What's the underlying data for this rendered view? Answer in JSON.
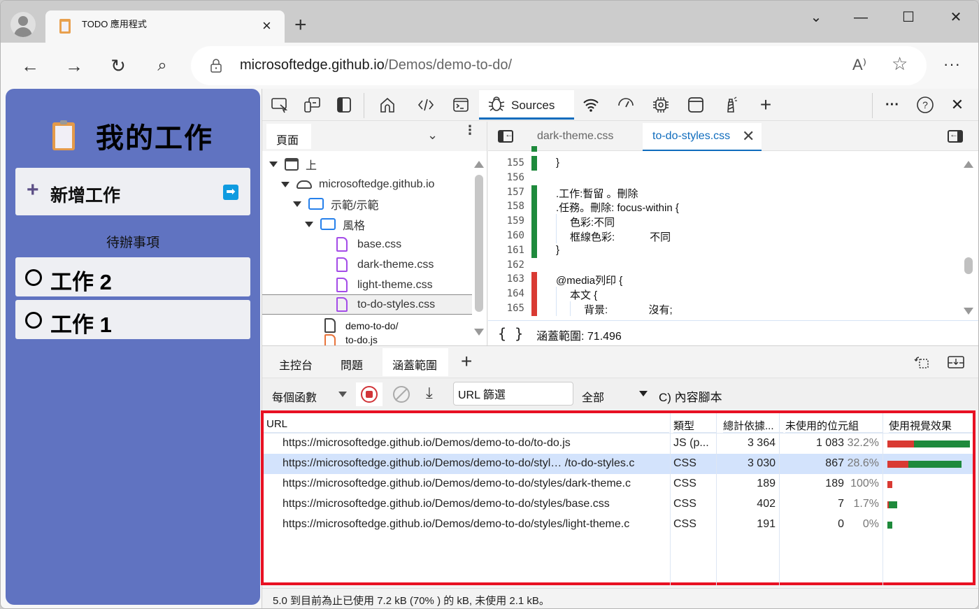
{
  "browser": {
    "tab_title": "TODO 應用程式",
    "tab_close": "×",
    "new_tab": "+",
    "window_controls": {
      "tab_search": "⌄",
      "minimize": "—",
      "maximize": "☐",
      "close": "✕"
    },
    "nav": {
      "back": "←",
      "forward": "→",
      "refresh": "↻",
      "search": "⌕"
    },
    "url_host": "microsoftedge.github.io",
    "url_path": "/Demos/demo-to-do/",
    "read_aloud": "A⁾",
    "favorite": "☆",
    "more": "···"
  },
  "app": {
    "title": "我的工作",
    "add_task_label": "新增工作",
    "add_task_plus": "+",
    "add_task_submit": "➡",
    "section_title": "待辦事項",
    "tasks": [
      {
        "label": "工作 2"
      },
      {
        "label": "工作 1"
      }
    ]
  },
  "devtools": {
    "toolbar": {
      "active_tab": "Sources",
      "more": "···",
      "help": "?",
      "close": "✕",
      "add": "+"
    },
    "navigator": {
      "tab": "頁面",
      "tree": [
        {
          "label": "上",
          "type": "frame",
          "depth": 0
        },
        {
          "label": "microsoftedge.github.io",
          "type": "domain",
          "depth": 1
        },
        {
          "label": "示範/示範",
          "type": "folder",
          "depth": 2
        },
        {
          "label": "風格",
          "type": "folder",
          "depth": 3
        },
        {
          "label": "base.css",
          "type": "css",
          "depth": 4
        },
        {
          "label": "dark-theme.css",
          "type": "css",
          "depth": 4
        },
        {
          "label": "light-theme.css",
          "type": "css",
          "depth": 4
        },
        {
          "label": "to-do-styles.css",
          "type": "css",
          "depth": 4,
          "selected": true
        },
        {
          "label": "demo-to-do/",
          "type": "document",
          "depth": 3
        },
        {
          "label": "to-do.js",
          "type": "js",
          "depth": 3
        }
      ]
    },
    "editor": {
      "tabs": [
        {
          "label": "dark-theme.css",
          "active": false
        },
        {
          "label": "to-do-styles.css",
          "active": true
        }
      ],
      "tab_close": "✕",
      "lines": [
        {
          "num": "155",
          "code": "}",
          "coverage": "used",
          "indent": 1
        },
        {
          "num": "156",
          "code": "",
          "coverage": "none",
          "indent": 0
        },
        {
          "num": "157",
          "code": ".工作:暫留 。刪除",
          "coverage": "used",
          "indent": 1
        },
        {
          "num": "158",
          "code": ".任務。刪除: focus-within {",
          "coverage": "used",
          "indent": 1
        },
        {
          "num": "159",
          "code": "色彩:不同",
          "coverage": "used",
          "indent": 2
        },
        {
          "num": "160",
          "code": "框線色彩:            不同",
          "coverage": "used",
          "indent": 2
        },
        {
          "num": "161",
          "code": "}",
          "coverage": "used",
          "indent": 1
        },
        {
          "num": "162",
          "code": "",
          "coverage": "none",
          "indent": 0
        },
        {
          "num": "163",
          "code": "@media列印 {",
          "coverage": "unused",
          "indent": 1
        },
        {
          "num": "164",
          "code": "本文 {",
          "coverage": "unused",
          "indent": 2
        },
        {
          "num": "165",
          "code": "背景:              沒有;",
          "coverage": "unused",
          "indent": 3
        }
      ],
      "footer_braces": "{ }",
      "footer_coverage": "涵蓋範圍: 71.496"
    },
    "drawer": {
      "tabs": [
        {
          "label": "主控台",
          "active": false
        },
        {
          "label": "問題",
          "active": false
        },
        {
          "label": "涵蓋範圍",
          "active": true
        }
      ],
      "add": "+"
    },
    "coverage": {
      "type_select": "每個函數",
      "url_filter_value": "URL 篩選",
      "all_select": "全部",
      "content_scripts": "C) 內容腳本",
      "export_icon": "⤓",
      "columns": [
        "URL",
        "類型",
        "總計依據...",
        "未使用的位元組",
        "使用視覺效果"
      ],
      "rows": [
        {
          "url": "https://microsoftedge.github.io/Demos/demo-to-do/to-do.js",
          "type": "JS (p...",
          "total": "3 364",
          "unused": "1 083",
          "unused_pct": "32.2%",
          "unused_fraction": 0.322,
          "total_value": 3364,
          "selected": false
        },
        {
          "url": "https://microsoftedge.github.io/Demos/demo-to-do/styl… /to-do-styles.c",
          "type": "CSS",
          "total": "3 030",
          "unused": "867",
          "unused_pct": "28.6%",
          "unused_fraction": 0.286,
          "total_value": 3030,
          "selected": true
        },
        {
          "url": "https://microsoftedge.github.io/Demos/demo-to-do/styles/dark-theme.c",
          "type": "CSS",
          "total": "189",
          "unused": "189",
          "unused_pct": "100%",
          "unused_fraction": 1.0,
          "total_value": 189,
          "selected": false
        },
        {
          "url": "https://microsoftedge.github.io/Demos/demo-to-do/styles/base.css",
          "type": "CSS",
          "total": "402",
          "unused": "7",
          "unused_pct": "1.7%",
          "unused_fraction": 0.017,
          "total_value": 402,
          "selected": false
        },
        {
          "url": "https://microsoftedge.github.io/Demos/demo-to-do/styles/light-theme.c",
          "type": "CSS",
          "total": "191",
          "unused": "0",
          "unused_pct": "0%",
          "unused_fraction": 0.0,
          "total_value": 191,
          "selected": false
        }
      ],
      "status": "5.0 到目前為止已使用 7.2 kB (70% ) 的 kB, 未使用 2.1 kB。"
    }
  },
  "colors": {
    "app_bg": "#6073c1",
    "used": "#1e8a3c",
    "unused": "#d93a33",
    "accent": "#0f6cbd",
    "highlight_border": "#e81123",
    "selected_row": "#d3e3fc"
  }
}
